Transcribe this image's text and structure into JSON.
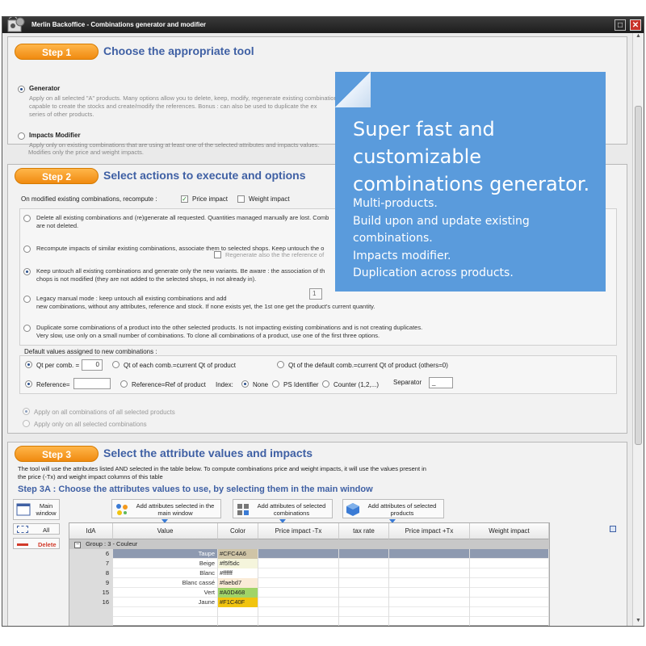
{
  "window": {
    "title": "Merlin Backoffice - Combinations generator and modifier",
    "max_glyph": "□",
    "close_glyph": "✕"
  },
  "step1": {
    "pill": "Step 1",
    "title": "Choose the appropriate tool",
    "generator_label": "Generator",
    "generator_desc1": "Apply on all selected \"A\" products. Many options allow you to delete, keep, modify, regenerate existing combinations",
    "generator_desc2": "capable to create the stocks and create/modify the references. Bonus : can also be used to duplicate the ex",
    "generator_desc3": "series of other products.",
    "impacts_label": "Impacts Modifier",
    "impacts_desc1": "Apply only on existing combinations that are using at least one of the selected attributes and impacts values.",
    "impacts_desc2": "Modifies only the price and weight impacts."
  },
  "step2": {
    "pill": "Step 2",
    "title": "Select actions to execute and options",
    "recompute_label": "On modified existing combinations, recompute :",
    "price_impact_label": "Price impact",
    "weight_impact_label": "Weight impact",
    "opt1_line1": "Delete all existing combinations and (re)generate all requested. Quantities managed manually are lost. Comb",
    "opt1_line2": "are not deleted.",
    "opt2_line1": "Recompute impacts of similar existing combinations, associate them to selected shops. Keep untouch the o",
    "opt2_overlay": "Regenerate also the the reference of",
    "opt3_line1": "Keep untouch all existing combinations and generate only the new variants. Be aware : the association of th",
    "opt3_line2": "chops is not modified (they are not added to the selected shops, in not already in).",
    "opt4_line1": "Legacy manual mode : keep untouch all existing combinations and add",
    "opt4_line2": "new combinations, without any attributes, reference and stock. If none exists yet, the 1st one get the product's current quantity.",
    "opt4_value": "1",
    "opt5_line1": "Duplicate some combinations of a product into the other selected products. Is not impacting existing combinations and is not creating duplicates.",
    "opt5_line2": "Very slow, use only on a small number of combinations. To clone all combinations of a product, use one of the first three options.",
    "defaults_label": "Default values assigned to new combinations :",
    "qt_per_comb_label": "Qt per comb. =",
    "qt_per_comb_value": "0",
    "qt_each_label": "Qt of each comb.=current Qt of product",
    "qt_default_label": "Qt of the default comb.=current Qt of product (others=0)",
    "reference_label": "Reference=",
    "reference_value": "",
    "reference_ref_label": "Reference=Ref of product",
    "index_label": "Index:",
    "index_none": "None",
    "index_ps": "PS Identifier",
    "index_counter": "Counter (1,2,...)",
    "separator_label": "Separator",
    "separator_value": "_",
    "apply_all_label": "Apply on all combinations of all selected products",
    "apply_selected_label": "Apply only on all selected combinations"
  },
  "step3": {
    "pill": "Step 3",
    "title": "Select the attribute values and impacts",
    "desc_line1": "The tool will use the attributes listed AND selected in the table below. To compute combinations price and weight impacts, it will use the values present in",
    "desc_line2": "the price (-Tx) and weight impact columns of this table",
    "subtitle": "Step 3A : Choose the attributes values to use, by selecting them in the main window",
    "main_window_btn": "Main\nwindow",
    "add_selected_main_btn": "Add attributes selected in the main window",
    "add_selected_combinations_btn": "Add attributes of selected combinations",
    "add_selected_products_btn": "Add attributes of selected products",
    "all_btn": "All",
    "delete_btn": "Delete"
  },
  "grid": {
    "columns": [
      "IdA",
      "Value",
      "Color",
      "Price impact -Tx",
      "tax rate",
      "Price impact +Tx",
      "Weight impact"
    ],
    "group_label": "Group :  3 - Couleur",
    "group_toggle": "−",
    "rows": [
      {
        "id": "6",
        "value": "Taupe",
        "color": "#CFC4A6",
        "swatch": "#CFC4A6",
        "selected": true
      },
      {
        "id": "7",
        "value": "Beige",
        "color": "#f5f5dc",
        "swatch": "#f5f5dc",
        "selected": false
      },
      {
        "id": "8",
        "value": "Blanc",
        "color": "#ffffff",
        "swatch": "#ffffff",
        "selected": false
      },
      {
        "id": "9",
        "value": "Blanc cassé",
        "color": "#faebd7",
        "swatch": "#faebd7",
        "selected": false
      },
      {
        "id": "15",
        "value": "Vert",
        "color": "#A0D468",
        "swatch": "#A0D468",
        "selected": false
      },
      {
        "id": "16",
        "value": "Jaune",
        "color": "#F1C40F",
        "swatch": "#F1C40F",
        "selected": false
      }
    ]
  },
  "callout": {
    "headline": "Super fast and customizable combinations generator.",
    "lines": [
      "Multi-products.",
      "Build upon and update existing combinations.",
      "Impacts modifier.",
      "Duplication across products."
    ]
  },
  "colors": {
    "accent": "#3f60a4",
    "step_pill": "#f39a1e",
    "callout": "#5a9bdc",
    "delete": "#d23a2a"
  }
}
